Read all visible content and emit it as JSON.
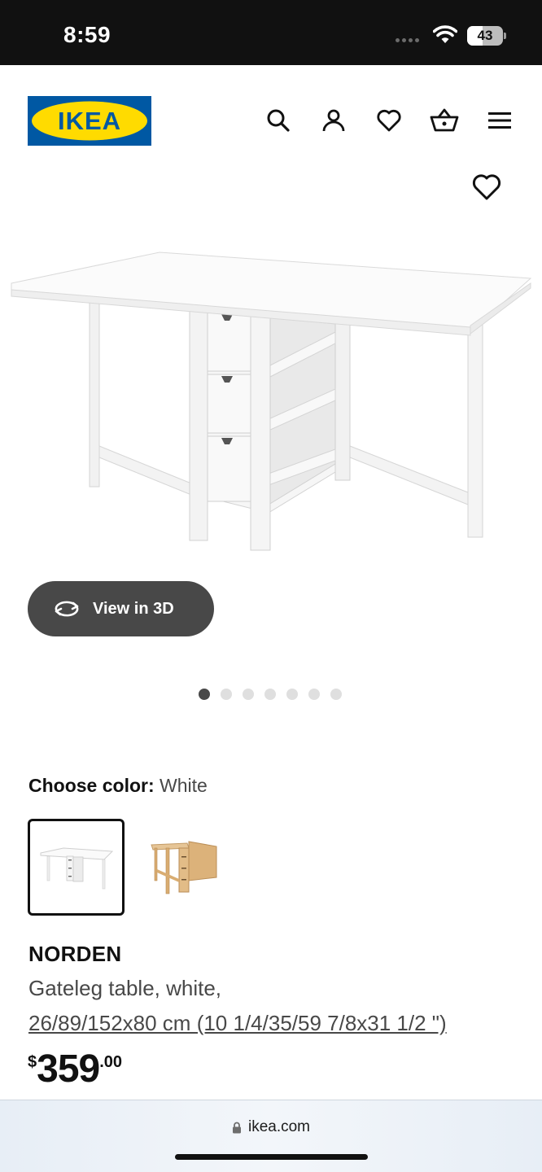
{
  "status_bar": {
    "time": "8:59",
    "battery_level": "43",
    "icons": [
      "signal-dots-icon",
      "wifi-icon",
      "battery-icon"
    ]
  },
  "header": {
    "logo_text": "IKEA",
    "icons": [
      "search-icon",
      "account-icon",
      "heart-icon",
      "cart-icon",
      "menu-icon"
    ],
    "brand_colors": {
      "blue": "#0058A3",
      "yellow": "#FFDB00"
    }
  },
  "gallery": {
    "favorite_icon": "heart-outline-icon",
    "view_3d_label": "View in 3D",
    "view_3d_icon": "rotate-3d-icon",
    "dot_count": 7,
    "active_dot": 0
  },
  "color_chooser": {
    "label": "Choose color:",
    "selected": "White",
    "options": [
      {
        "name": "White",
        "color": "#ffffff",
        "selected": true
      },
      {
        "name": "Birch",
        "color": "#d9b27e",
        "selected": false
      }
    ]
  },
  "product": {
    "name": "NORDEN",
    "description": "Gateleg table, white,",
    "size": "26/89/152x80 cm (10 1/4/35/59 7/8x31 1/2 \")",
    "price": {
      "currency": "$",
      "integer": "359",
      "decimals": ".00"
    }
  },
  "browser": {
    "lock_icon": "lock-icon",
    "url": "ikea.com"
  }
}
